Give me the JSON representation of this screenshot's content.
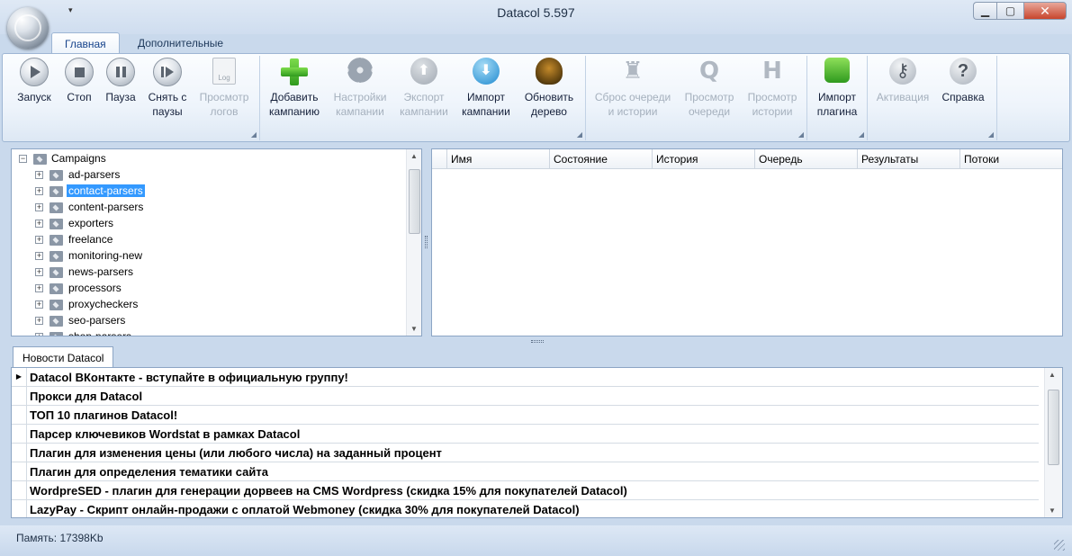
{
  "window": {
    "title": "Datacol 5.597",
    "qat_arrow": "▾",
    "controls": {
      "minimize": "▁",
      "maximize": "▢",
      "close": "✕"
    }
  },
  "ribbon_tabs": [
    "Главная",
    "Дополнительные"
  ],
  "ribbon": {
    "buttons": [
      {
        "id": "start",
        "label": "Запуск",
        "icon": "play-icon",
        "enabled": true
      },
      {
        "id": "stop",
        "label": "Стоп",
        "icon": "stop-icon",
        "enabled": true
      },
      {
        "id": "pause",
        "label": "Пауза",
        "icon": "pause-icon",
        "enabled": true
      },
      {
        "id": "resume",
        "label": "Снять с\nпаузы",
        "icon": "resume-icon",
        "enabled": true
      },
      {
        "id": "view_logs",
        "label": "Просмотр\nлогов",
        "icon": "log-document-icon",
        "enabled": false,
        "icon_text": "Log"
      },
      {
        "id": "add_campaign",
        "label": "Добавить\nкампанию",
        "icon": "plus-icon",
        "enabled": true
      },
      {
        "id": "campaign_settings",
        "label": "Настройки\nкампании",
        "icon": "gear-icon",
        "enabled": false
      },
      {
        "id": "export_campaign",
        "label": "Экспорт\nкампании",
        "icon": "export-arrow-icon",
        "enabled": false,
        "glyph": "⬆"
      },
      {
        "id": "import_campaign",
        "label": "Импорт\nкампании",
        "icon": "import-arrow-icon",
        "enabled": true,
        "glyph": "⬇"
      },
      {
        "id": "refresh_tree",
        "label": "Обновить\nдерево",
        "icon": "tree-icon",
        "enabled": true
      },
      {
        "id": "reset_queue",
        "label": "Сброс очереди\nи истории",
        "icon": "reset-people-icon",
        "enabled": false,
        "glyph": "♜"
      },
      {
        "id": "view_queue",
        "label": "Просмотр\nочереди",
        "icon": "queue-q-icon",
        "enabled": false,
        "glyph": "Q"
      },
      {
        "id": "view_history",
        "label": "Просмотр\nистории",
        "icon": "history-h-icon",
        "enabled": false,
        "glyph": "H"
      },
      {
        "id": "import_plugin",
        "label": "Импорт\nплагина",
        "icon": "puzzle-icon",
        "enabled": true
      },
      {
        "id": "activation",
        "label": "Активация",
        "icon": "key-icon",
        "enabled": false,
        "glyph": "⚷"
      },
      {
        "id": "help",
        "label": "Справка",
        "icon": "help-icon",
        "enabled": true,
        "glyph": "?"
      }
    ]
  },
  "tree": {
    "root": "Campaigns",
    "root_expander": "−",
    "child_expander": "+",
    "items": [
      "ad-parsers",
      "contact-parsers",
      "content-parsers",
      "exporters",
      "freelance",
      "monitoring-new",
      "news-parsers",
      "processors",
      "proxycheckers",
      "seo-parsers",
      "shop-parsers"
    ],
    "selected": "contact-parsers",
    "scroll_up": "▲",
    "scroll_down": "▼"
  },
  "grid": {
    "columns": [
      "Имя",
      "Состояние",
      "История",
      "Очередь",
      "Результаты",
      "Потоки"
    ]
  },
  "news": {
    "tab_label": "Новости Datacol",
    "row_indicator": "▶",
    "items": [
      "Datacol ВКонтакте - вступайте в официальную группу!",
      "Прокси для Datacol",
      "ТОП 10 плагинов Datacol!",
      "Парсер ключевиков Wordstat в рамках Datacol",
      "Плагин для изменения цены (или любого числа) на заданный процент",
      "Плагин для определения тематики сайта",
      "WordpreSED - плагин для генерации дорвеев на CMS Wordpress (скидка 15% для покупателей Datacol)",
      "LazyPay - Скрипт онлайн-продажи с оплатой Webmoney (скидка 30% для покупателей Datacol)"
    ]
  },
  "status": {
    "memory": "Память: 17398Kb"
  }
}
